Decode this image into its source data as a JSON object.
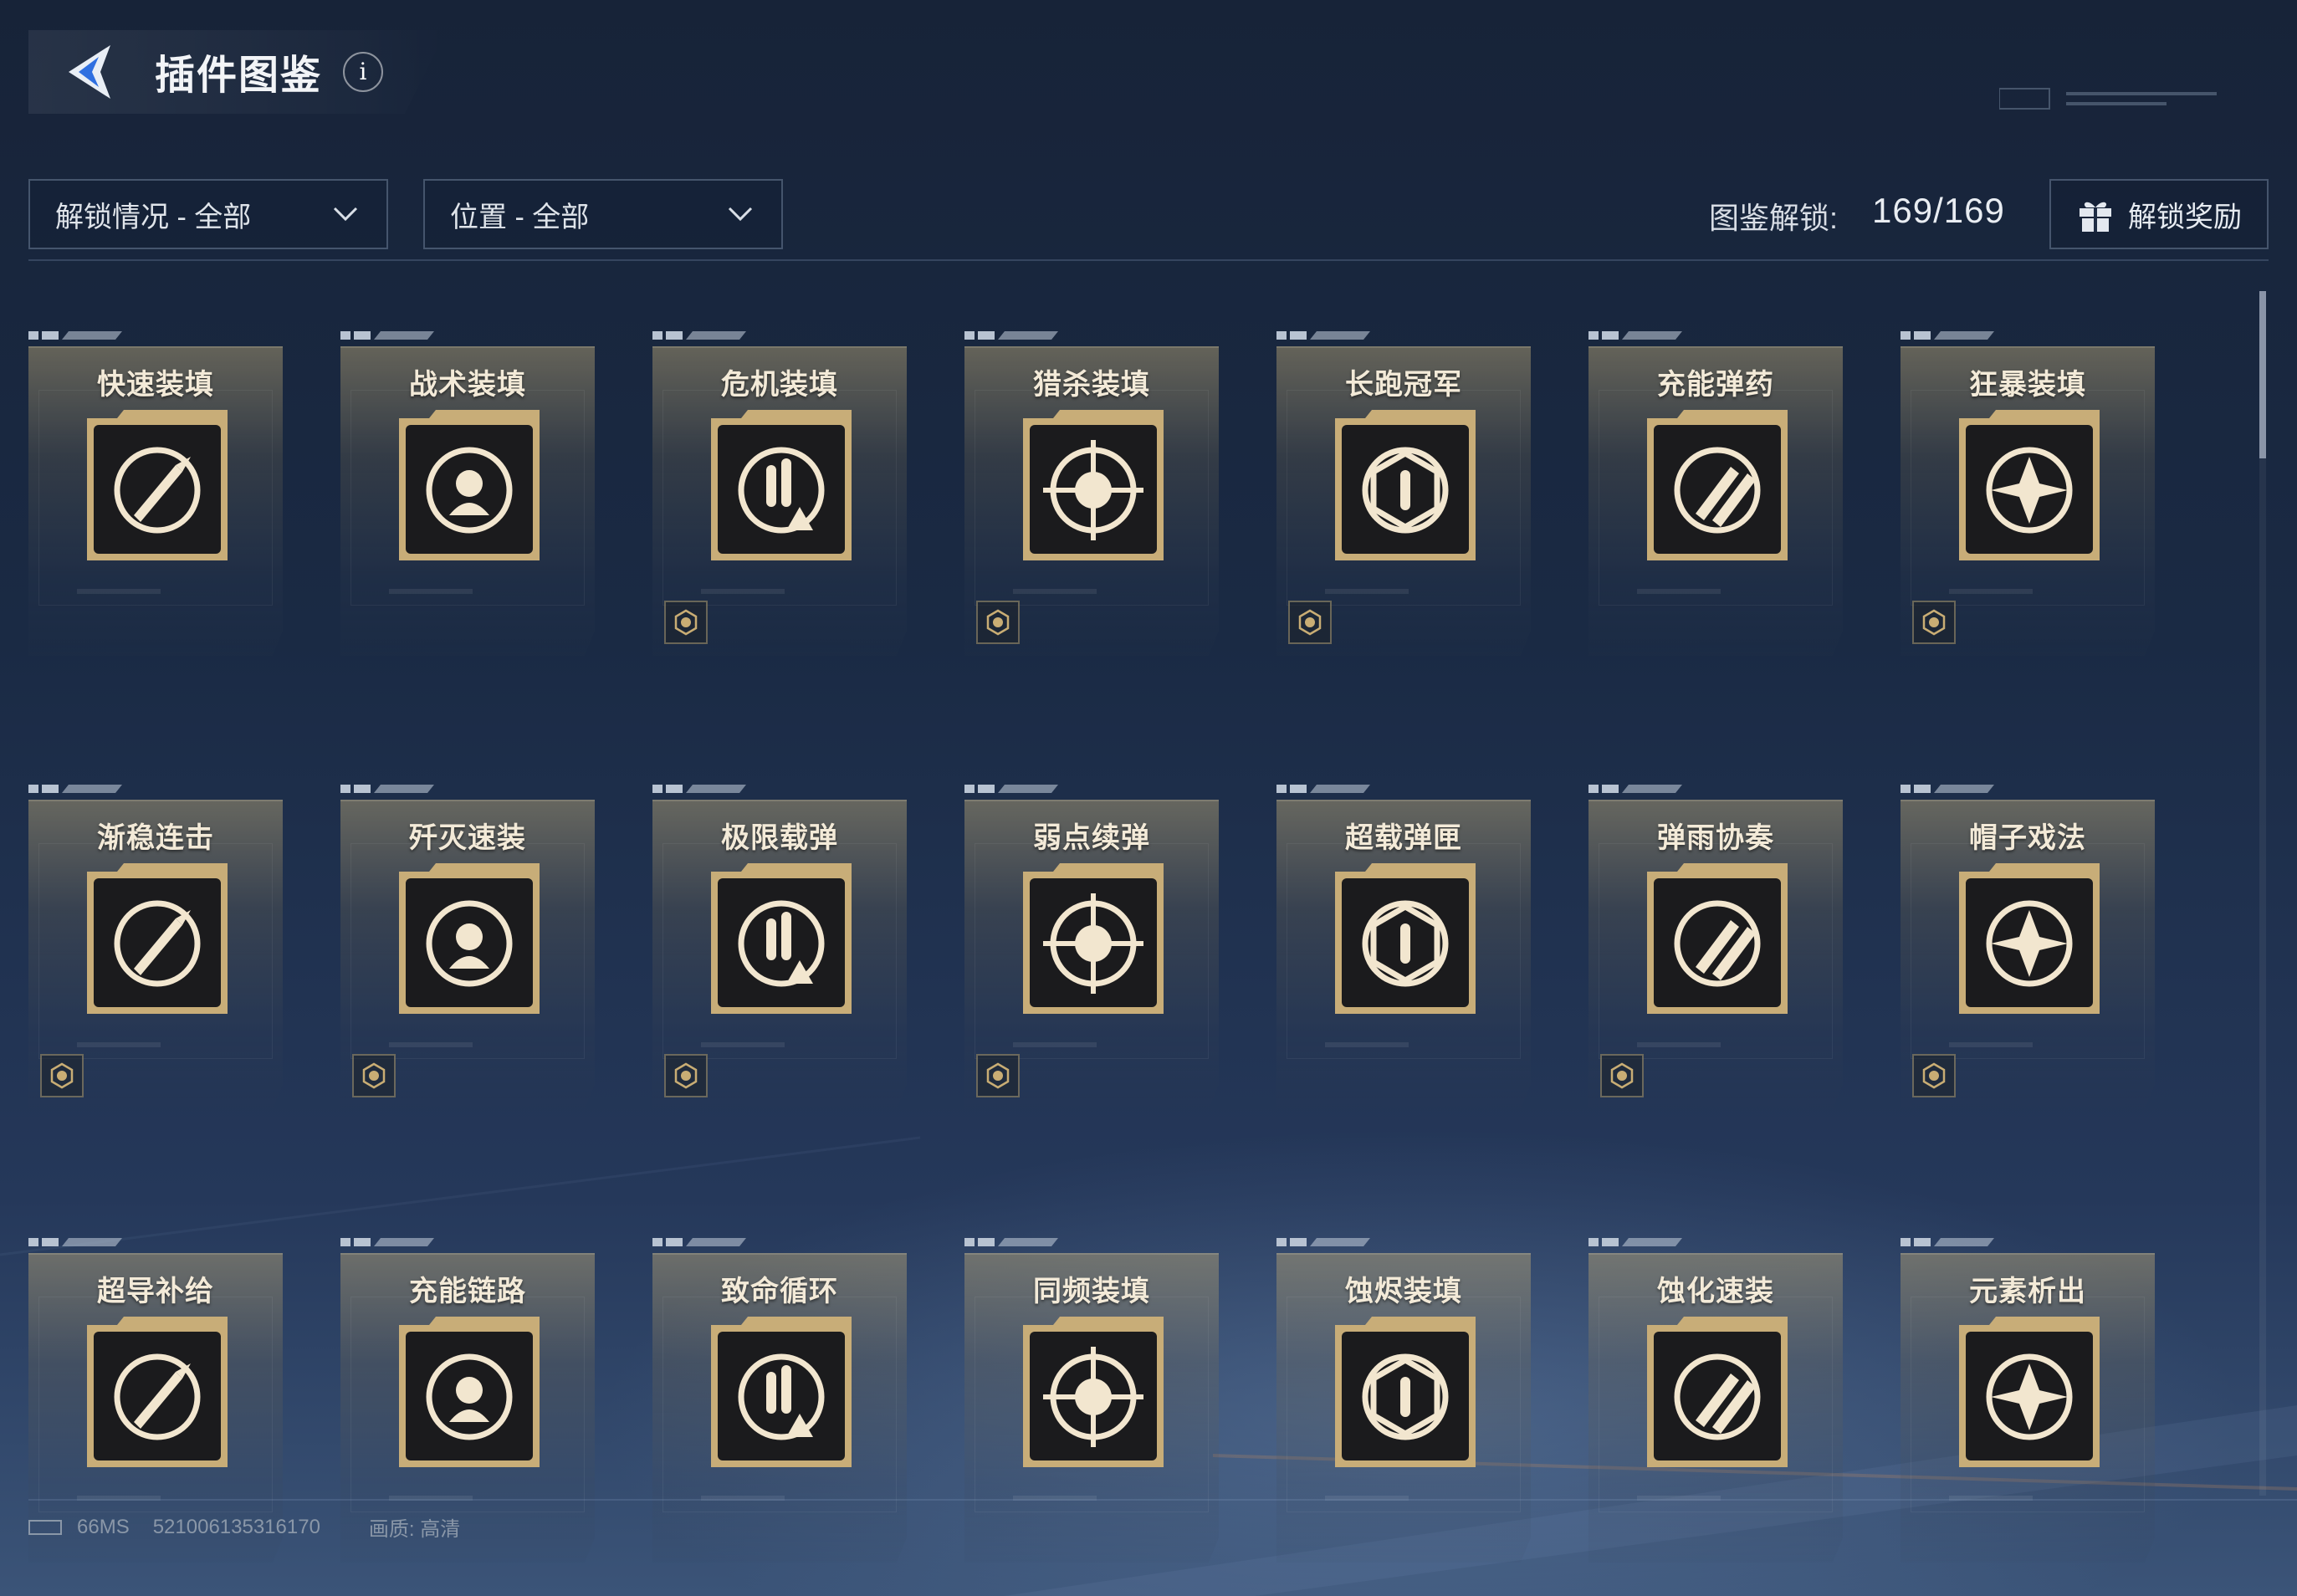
{
  "header": {
    "title": "插件图鉴",
    "info_label": "i"
  },
  "filters": {
    "unlock_status": "解锁情况 - 全部",
    "position": "位置 - 全部"
  },
  "progress": {
    "label": "图鉴解锁:",
    "value": "169/169"
  },
  "reward_button": {
    "label": "解锁奖励"
  },
  "colors": {
    "card_gold": "#c8ad78",
    "icon_bg": "#1b1b1d",
    "icon_fg": "#f2e6cf"
  },
  "cards": [
    {
      "name": "快速装填",
      "icon": "dual-rocket-reload-icon",
      "badge": false
    },
    {
      "name": "战术装填",
      "icon": "target-head-ammo-icon",
      "badge": false
    },
    {
      "name": "危机装填",
      "icon": "ammo-warning-icon",
      "badge": true
    },
    {
      "name": "猎杀装填",
      "icon": "crosshair-ammo-icon",
      "badge": true
    },
    {
      "name": "长跑冠军",
      "icon": "runner-hex-ammo-icon",
      "badge": true
    },
    {
      "name": "充能弹药",
      "icon": "twin-rockets-icon",
      "badge": false
    },
    {
      "name": "狂暴装填",
      "icon": "burst-pistol-icon",
      "badge": true
    },
    {
      "name": "渐稳连击",
      "icon": "converging-chevrons-icon",
      "badge": true
    },
    {
      "name": "歼灭速装",
      "icon": "bullets-up-arrow-icon",
      "badge": true
    },
    {
      "name": "极限载弹",
      "icon": "bullets-cycle-icon",
      "badge": true
    },
    {
      "name": "弱点续弹",
      "icon": "target-up-arrow-icon",
      "badge": true
    },
    {
      "name": "超载弹匣",
      "icon": "magazine-up-arrow-icon",
      "badge": false
    },
    {
      "name": "弹雨协奏",
      "icon": "bullet-rain-icon",
      "badge": true
    },
    {
      "name": "帽子戏法",
      "icon": "bullets-hat-icon",
      "badge": true
    },
    {
      "name": "超导补给",
      "icon": "shield-wings-ammo-icon",
      "badge": false
    },
    {
      "name": "充能链路",
      "icon": "hex-network-bullet-icon",
      "badge": false
    },
    {
      "name": "致命循环",
      "icon": "warning-cycle-icon",
      "badge": false
    },
    {
      "name": "同频装填",
      "icon": "bullet-orbit-icon",
      "badge": false
    },
    {
      "name": "蚀烬装填",
      "icon": "crossed-blades-icon",
      "badge": false
    },
    {
      "name": "蚀化速装",
      "icon": "head-cycle-ammo-icon",
      "badge": false
    },
    {
      "name": "元素析出",
      "icon": "hex-bullet-icon",
      "badge": false
    }
  ],
  "footer": {
    "ping": "66MS",
    "uid": "521006135316170",
    "quality": "画质: 高清"
  }
}
